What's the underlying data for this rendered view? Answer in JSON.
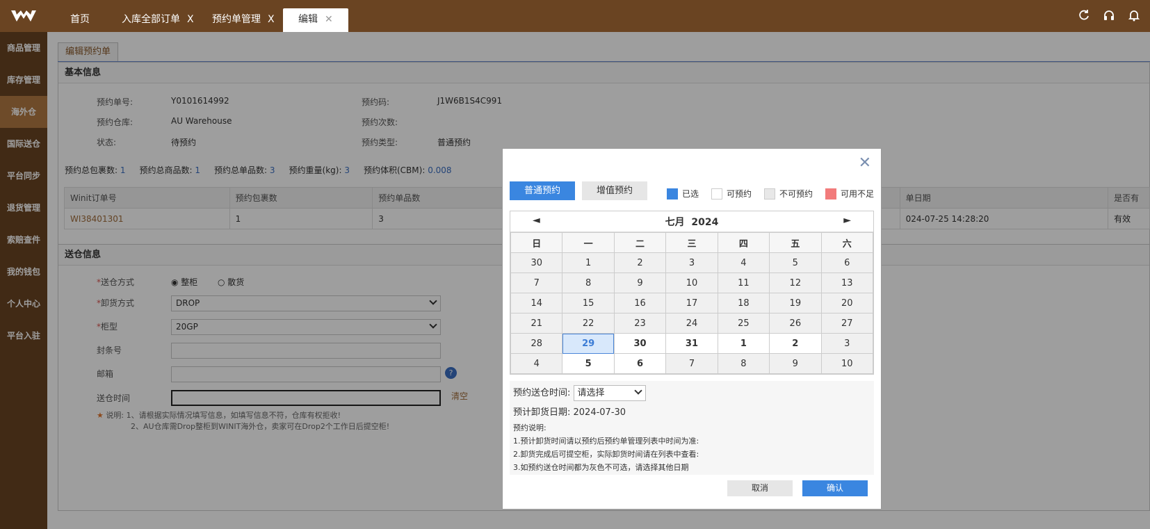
{
  "topbar": {
    "tabs": [
      {
        "label": "首页",
        "closable": false
      },
      {
        "label": "入库全部订单",
        "closable": true
      },
      {
        "label": "预约单管理",
        "closable": true
      },
      {
        "label": "编辑",
        "closable": true,
        "active": true
      }
    ],
    "close_glyph": "X",
    "active_close_glyph": "✕",
    "icons": [
      "refresh-icon",
      "headset-icon",
      "bell-icon"
    ]
  },
  "sidebar": {
    "items": [
      {
        "label": "商品管理"
      },
      {
        "label": "库存管理"
      },
      {
        "label": "海外仓",
        "active": true
      },
      {
        "label": "国际送仓"
      },
      {
        "label": "平台同步"
      },
      {
        "label": "退货管理"
      },
      {
        "label": "索赔查件"
      },
      {
        "label": "我的钱包"
      },
      {
        "label": "个人中心"
      },
      {
        "label": "平台入驻"
      }
    ]
  },
  "page": {
    "tab_label": "编辑预约单",
    "basic": {
      "title": "基本信息",
      "fields": {
        "order_no_label": "预约单号:",
        "order_no": "Y0101614992",
        "code_label": "预约码:",
        "code": "J1W6B1S4C991",
        "warehouse_label": "预约仓库:",
        "warehouse": "AU Warehouse",
        "times_label": "预约次数:",
        "times": "",
        "status_label": "状态:",
        "status": "待预约",
        "type_label": "预约类型:",
        "type": "普通预约"
      },
      "summary": [
        {
          "label": "预约总包裹数:",
          "value": "1"
        },
        {
          "label": "预约总商品数:",
          "value": "1"
        },
        {
          "label": "预约总单品数:",
          "value": "3"
        },
        {
          "label": "预约重量(kg):",
          "value": "3"
        },
        {
          "label": "预约体积(CBM):",
          "value": "0.008"
        }
      ],
      "table": {
        "headers": [
          "Winit订单号",
          "预约包裹数",
          "预约单品数",
          "单日期",
          "是否有"
        ],
        "rows": [
          [
            "WI38401301",
            "1",
            "3",
            "024-07-25 14:28:20",
            "有效"
          ]
        ]
      }
    },
    "delivery": {
      "title": "送仓信息",
      "method_label": "送仓方式",
      "method_options": [
        "整柜",
        "散货"
      ],
      "unload_label": "卸货方式",
      "unload_value": "DROP",
      "cabinet_label": "柜型",
      "cabinet_value": "20GP",
      "seal_label": "封条号",
      "mailbox_label": "邮箱",
      "time_label": "送仓时间",
      "clear_label": "清空",
      "note_label": "说明:",
      "note_1": "1、请根据实际情况填写信息，如填写信息不符，仓库有权拒收!",
      "note_2": "2、AU仓库需Drop整柜到WINIT海外仓，卖家可在Drop2个工作日后提空柜!"
    }
  },
  "modal": {
    "tabs": [
      "普通预约",
      "增值预约"
    ],
    "legend": [
      {
        "label": "已选",
        "color": "#3a86e0"
      },
      {
        "label": "可预约",
        "color": "#ffffff"
      },
      {
        "label": "不可预约",
        "color": "#e8e8e8"
      },
      {
        "label": "可用不足",
        "color": "#f27b7b"
      }
    ],
    "calendar": {
      "month_label": "七月",
      "year": "2024",
      "prev": "◄",
      "next": "►",
      "weekdays": [
        "日",
        "一",
        "二",
        "三",
        "四",
        "五",
        "六"
      ],
      "weeks": [
        [
          "30",
          "1",
          "2",
          "3",
          "4",
          "5",
          "6"
        ],
        [
          "7",
          "8",
          "9",
          "10",
          "11",
          "12",
          "13"
        ],
        [
          "14",
          "15",
          "16",
          "17",
          "18",
          "19",
          "20"
        ],
        [
          "21",
          "22",
          "23",
          "24",
          "25",
          "26",
          "27"
        ],
        [
          "28",
          "29",
          "30",
          "31",
          "1",
          "2",
          "3"
        ],
        [
          "4",
          "5",
          "6",
          "7",
          "8",
          "9",
          "10"
        ]
      ],
      "selected": "29"
    },
    "time_label": "预约送仓时间:",
    "time_placeholder": "请选择",
    "unload_date": "预计卸货日期: 2024-07-30",
    "notes_title": "预约说明:",
    "notes": [
      "1.预计卸货时间请以预约后预约单管理列表中时间为准:",
      "2.卸货完成后可提空柜，实际卸货时间请在列表中查看:",
      "3.如预约送仓时间都为灰色不可选，请选择其他日期"
    ],
    "cancel": "取消",
    "confirm": "确认",
    "close": "✕"
  }
}
